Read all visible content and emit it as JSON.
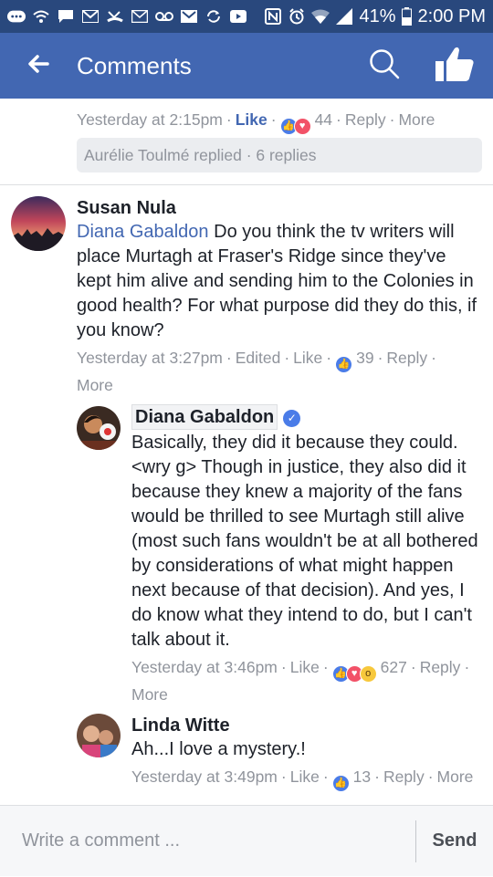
{
  "status_bar": {
    "battery": "41%",
    "time": "2:00 PM",
    "icons": [
      "more-icon",
      "wifi-call-icon",
      "chat-icon",
      "gmail-icon",
      "missed-call-icon",
      "mail-icon",
      "voicemail-icon",
      "gmail-icon",
      "sync-icon",
      "youtube-icon",
      "nfc-icon",
      "alarm-icon",
      "wifi-icon",
      "signal-icon",
      "battery-icon"
    ]
  },
  "header": {
    "title": "Comments",
    "icons": [
      "back-arrow-icon",
      "search-icon",
      "like-thumb-icon"
    ]
  },
  "comments": {
    "c0": {
      "time": "Yesterday at 2:15pm",
      "like": "Like",
      "count": "44",
      "reply": "Reply",
      "more": "More",
      "replies": "Aurélie Toulmé replied · 6 replies"
    },
    "c1": {
      "author": "Susan Nula",
      "tag": "Diana Gabaldon",
      "text": " Do you think the tv writers will place Murtagh at Fraser's Ridge since they've kept him alive and sending him to the Colonies in good health? For what purpose did they do this, if you know?",
      "time": "Yesterday at 3:27pm",
      "edited": "Edited",
      "like": "Like",
      "count": "39",
      "reply": "Reply",
      "more": "More"
    },
    "c2": {
      "author": "Diana Gabaldon",
      "text": "Basically, they did it because they could. <wry g> Though in justice, they also did it because they knew a majority of the fans would be thrilled to see Murtagh still alive (most such fans wouldn't be at all bothered by considerations of what might happen next because of that decision). And yes, I do know what they intend to do, but I can't talk about it.",
      "time": "Yesterday at 3:46pm",
      "like": "Like",
      "count": "627",
      "reply": "Reply",
      "more": "More"
    },
    "c3": {
      "author": "Linda Witte",
      "text": "Ah...I love a mystery.!",
      "time": "Yesterday at 3:49pm",
      "like": "Like",
      "count": "13",
      "reply": "Reply",
      "more": "More"
    }
  },
  "composer": {
    "placeholder": "Write a comment ...",
    "send": "Send"
  },
  "colors": {
    "status_bar": "#29487d",
    "app_bar": "#4267b2",
    "link": "#4267b2",
    "meta": "#90949c"
  }
}
